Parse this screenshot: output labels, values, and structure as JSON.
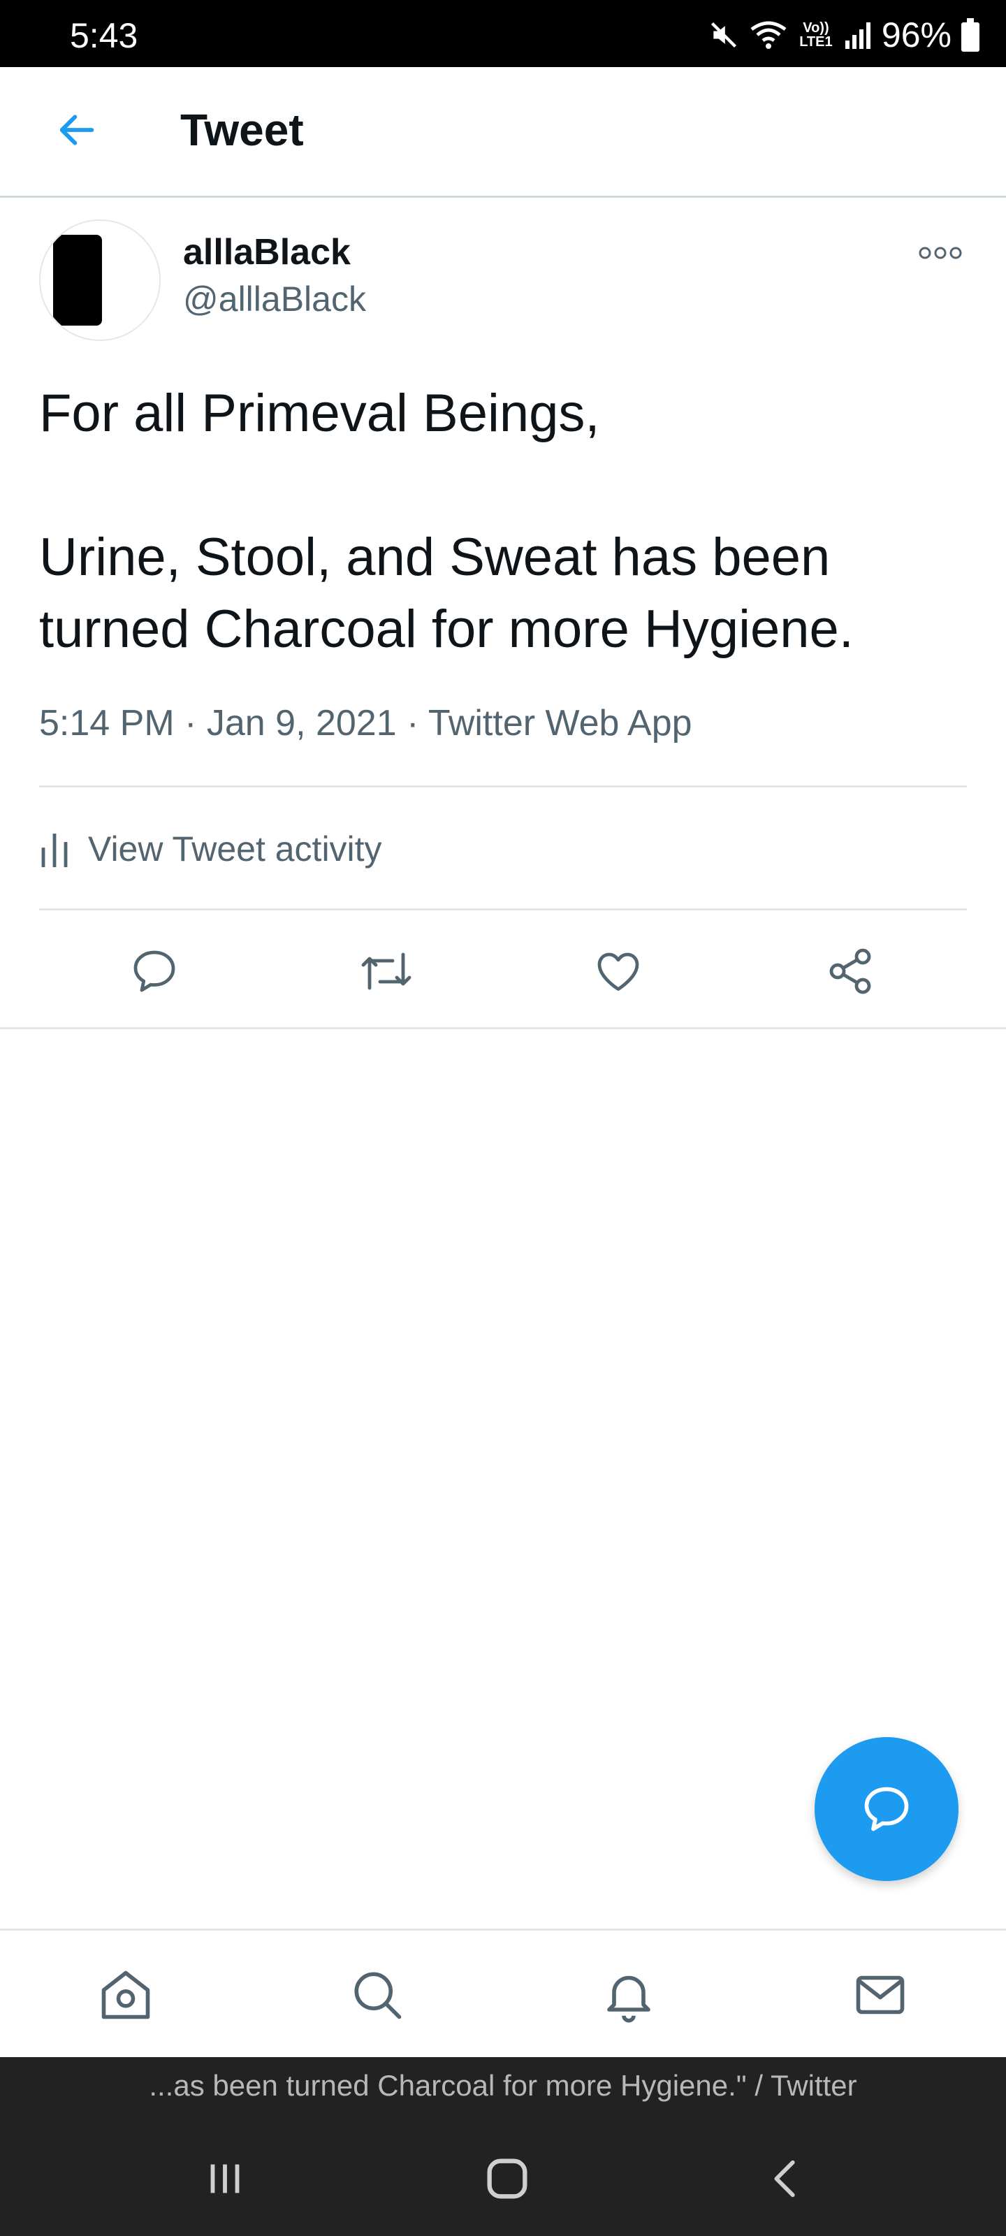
{
  "status_bar": {
    "time": "5:43",
    "network_label": "Vo)) LTE1",
    "battery": "96%"
  },
  "header": {
    "title": "Tweet",
    "back_icon": "arrow-left-icon"
  },
  "tweet": {
    "display_name": "alllaBlack",
    "handle": "@alllaBlack",
    "text_lines": [
      "For all Primeval Beings,",
      "Urine, Stool, and Sweat has been turned Charcoal for more Hygiene."
    ],
    "meta": "5:14 PM · Jan 9, 2021 · Twitter Web App",
    "activity_label": "View Tweet activity"
  },
  "actions": [
    {
      "icon": "reply-icon"
    },
    {
      "icon": "retweet-icon"
    },
    {
      "icon": "like-icon"
    },
    {
      "icon": "share-icon"
    }
  ],
  "bottom_nav": [
    {
      "icon": "home-icon"
    },
    {
      "icon": "search-icon"
    },
    {
      "icon": "notifications-icon"
    },
    {
      "icon": "messages-icon"
    }
  ],
  "caption": "...as been turned Charcoal for more Hygiene.\" / Twitter",
  "colors": {
    "accent": "#1d9bf0",
    "secondary_text": "#536471",
    "divider": "#e1e8ed",
    "system_bar": "#222222"
  }
}
